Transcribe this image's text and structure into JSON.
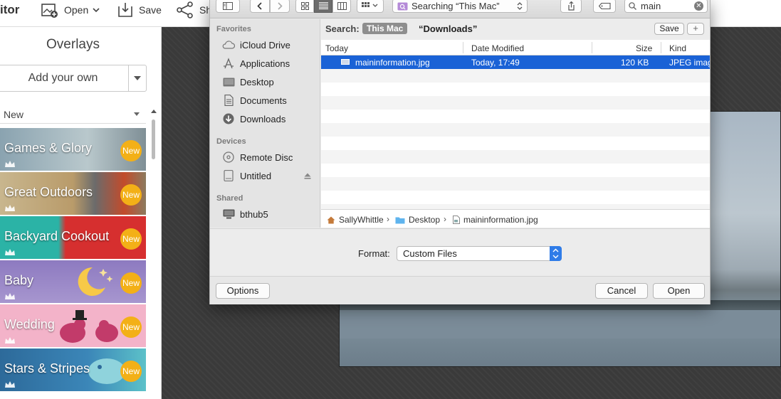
{
  "app": {
    "toolbar": {
      "title_fragment": "itor",
      "open_label": "Open",
      "save_label": "Save",
      "share_label": "Sh"
    },
    "sidebar": {
      "title": "Overlays",
      "add_own_label": "Add your own",
      "filter_value": "New",
      "tiles": [
        {
          "label": "Games & Glory",
          "badge": "New"
        },
        {
          "label": "Great Outdoors",
          "badge": "New"
        },
        {
          "label": "Backyard Cookout",
          "badge": "New"
        },
        {
          "label": "Baby",
          "badge": "New"
        },
        {
          "label": "Wedding",
          "badge": "New"
        },
        {
          "label": "Stars & Stripes",
          "badge": "New"
        }
      ]
    }
  },
  "dialog": {
    "toolbar": {
      "search_scope": "Searching “This Mac”",
      "search_query": "main"
    },
    "sidebar": {
      "favorites_heading": "Favorites",
      "favorites": [
        "iCloud Drive",
        "Applications",
        "Desktop",
        "Documents",
        "Downloads"
      ],
      "devices_heading": "Devices",
      "devices": [
        "Remote Disc",
        "Untitled"
      ],
      "shared_heading": "Shared",
      "shared": [
        "bthub5"
      ]
    },
    "searchbar": {
      "label": "Search:",
      "scope_this_mac": "This Mac",
      "scope_folder": "“Downloads”",
      "save_label": "Save",
      "plus_label": "+"
    },
    "columns": {
      "name": "Today",
      "date": "Date Modified",
      "size": "Size",
      "kind": "Kind"
    },
    "files": [
      {
        "name": "maininformation.jpg",
        "date": "Today, 17:49",
        "size": "120 KB",
        "kind": "JPEG imag"
      }
    ],
    "path": [
      "SallyWhittle",
      "Desktop",
      "maininformation.jpg"
    ],
    "format_label": "Format:",
    "format_value": "Custom Files",
    "options_label": "Options",
    "cancel_label": "Cancel",
    "open_label": "Open"
  },
  "colors": {
    "selection": "#1a62d6",
    "badge": "#f3b017",
    "select_stepper": "#2f7ce8"
  }
}
